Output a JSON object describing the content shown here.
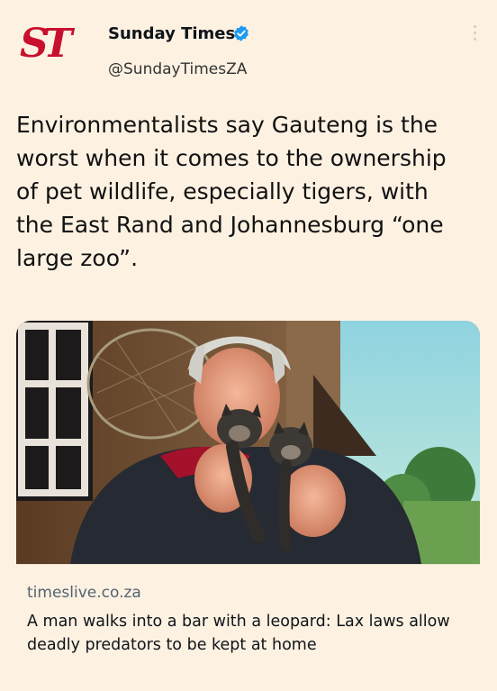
{
  "author": {
    "logo_text": "ST",
    "name": "Sunday Times",
    "handle": "@SundayTimesZA",
    "verified_icon": "verified-badge-icon",
    "more_icon": "more-options-icon"
  },
  "tweet": {
    "text": "Environmentalists say Gauteng is the worst when it comes to the ownership of pet wildlife, especially tigers, with the East Rand and Johannesburg “one large zoo”."
  },
  "link_card": {
    "image": "woman-holding-two-animal-cubs-photo",
    "domain": "timeslive.co.za",
    "headline": "A man walks into a bar with a leopard: Lax laws allow deadly predators to be kept at home"
  },
  "colors": {
    "background": "#fdf1e2",
    "brand_red": "#c8102e",
    "verified_blue": "#1d9bf0",
    "secondary_text": "#536471"
  }
}
